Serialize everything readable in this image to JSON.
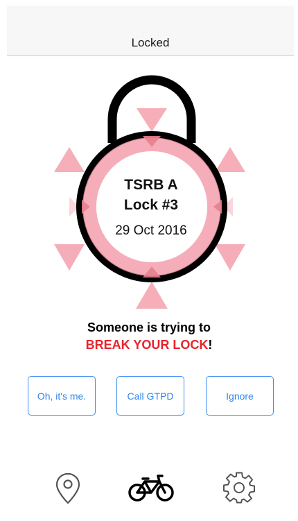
{
  "nav": {
    "title": "Locked"
  },
  "lock": {
    "name": "TSRB A",
    "number": "Lock #3",
    "date": "29 Oct 2016"
  },
  "alert": {
    "line1": "Someone is trying to",
    "danger_text": "BREAK YOUR LOCK",
    "suffix": "!"
  },
  "actions": {
    "me_label": "Oh, it's me.",
    "gtpd_label": "Call GTPD",
    "ignore_label": "Ignore"
  },
  "tab_bar": {
    "items": [
      {
        "icon": "location-pin-icon"
      },
      {
        "icon": "bicycle-icon"
      },
      {
        "icon": "gear-icon"
      }
    ]
  },
  "colors": {
    "accent": "#2f86ef",
    "danger": "#e8242c",
    "alert_pink": "#f4a0ad"
  }
}
